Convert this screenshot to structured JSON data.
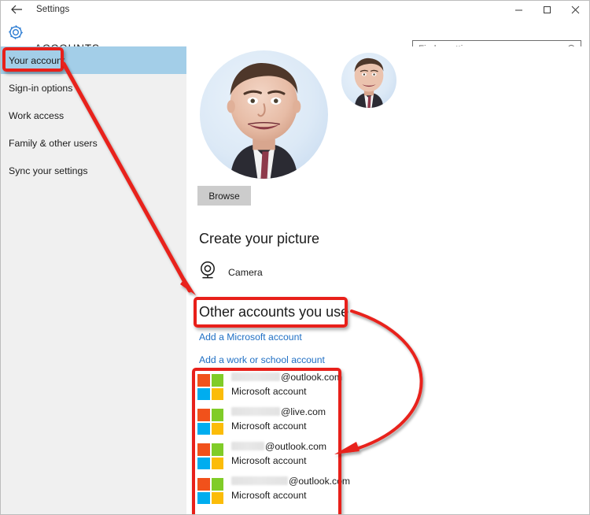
{
  "window": {
    "title": "Settings",
    "back_icon": "back-arrow-icon",
    "minimize_label": "─",
    "maximize_label": "▭",
    "close_label": "✕"
  },
  "header": {
    "gear_icon": "gear-icon",
    "page_title": "ACCOUNTS",
    "search_placeholder": "Find a setting",
    "search_value": "",
    "search_icon": "search-icon"
  },
  "sidebar": {
    "items": [
      {
        "label": "Your account",
        "selected": true
      },
      {
        "label": "Sign-in options",
        "selected": false
      },
      {
        "label": "Work access",
        "selected": false
      },
      {
        "label": "Family & other users",
        "selected": false
      },
      {
        "label": "Sync your settings",
        "selected": false
      }
    ]
  },
  "main": {
    "avatar_large_alt": "user-profile-picture-large",
    "avatar_small_alt": "user-profile-picture-small",
    "browse_label": "Browse",
    "create_picture_heading": "Create your picture",
    "camera_label": "Camera",
    "camera_icon": "camera-icon",
    "other_accounts_heading": "Other accounts you use",
    "add_microsoft_account_link": "Add a Microsoft account",
    "add_work_school_link": "Add a work or school account",
    "accounts": [
      {
        "email_suffix": "@outlook.com",
        "redacted_width": 62,
        "type": "Microsoft account"
      },
      {
        "email_suffix": "@live.com",
        "redacted_width": 62,
        "type": "Microsoft account"
      },
      {
        "email_suffix": "@outlook.com",
        "redacted_width": 42,
        "type": "Microsoft account"
      },
      {
        "email_suffix": "@outlook.com",
        "redacted_width": 72,
        "type": "Microsoft account"
      }
    ]
  },
  "annotations": {
    "color": "#e8201a",
    "boxes": [
      {
        "name": "your-account-highlight"
      },
      {
        "name": "other-accounts-heading-highlight"
      },
      {
        "name": "accounts-list-highlight"
      }
    ],
    "arrows": [
      {
        "name": "arrow-your-account-to-other-accounts"
      },
      {
        "name": "arrow-other-accounts-to-accounts-list"
      }
    ]
  },
  "colors": {
    "accent_link": "#1f6fc4",
    "selected_nav": "#a3cee8",
    "sidebar_bg": "#f0f0f0",
    "annotation_red": "#e8201a",
    "ms_logo_red": "#f1511b",
    "ms_logo_green": "#80cc28",
    "ms_logo_blue": "#00adef",
    "ms_logo_yellow": "#fbbc09"
  }
}
